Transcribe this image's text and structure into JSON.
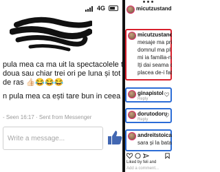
{
  "status_bar": {
    "network": "4G",
    "signal_icon": "signal-icon",
    "battery_icon": "battery-icon"
  },
  "messenger": {
    "message_lines": [
      "pula mea ca ma uit la spectacolele tale",
      "doua sau chiar trei ori pe luna și tot nu",
      "de ras 👍🏻😂😂😂",
      "n pula mea ca ești tare bun in ceea ce"
    ],
    "seen_text": "- Seen 16:17 · Sent from Messenger",
    "composer_placeholder": "Write a message...",
    "like_icon": "thumbs-up-icon"
  },
  "instagram": {
    "top_user": "micutzustandu",
    "highlighted_comment": {
      "user": "micutzustandu",
      "lines": [
        "mesaje ma pri",
        "domnul ma pl",
        "mi ia familia-n",
        "Iți dai seama c",
        "placea de-i fat"
      ]
    },
    "comments": [
      {
        "user": "ginapistol",
        "reply_label": "Reply"
      },
      {
        "user": "dorutodoru",
        "reply_label": "Reply"
      },
      {
        "user": "andreitstoica",
        "text": "sara și la bataia"
      }
    ],
    "liked_by": "Liked by feli",
    "liked_by_suffix": "and",
    "add_comment_placeholder": "Add a comment...",
    "accent_red": "#d8202c",
    "accent_blue": "#2b6cd6"
  }
}
